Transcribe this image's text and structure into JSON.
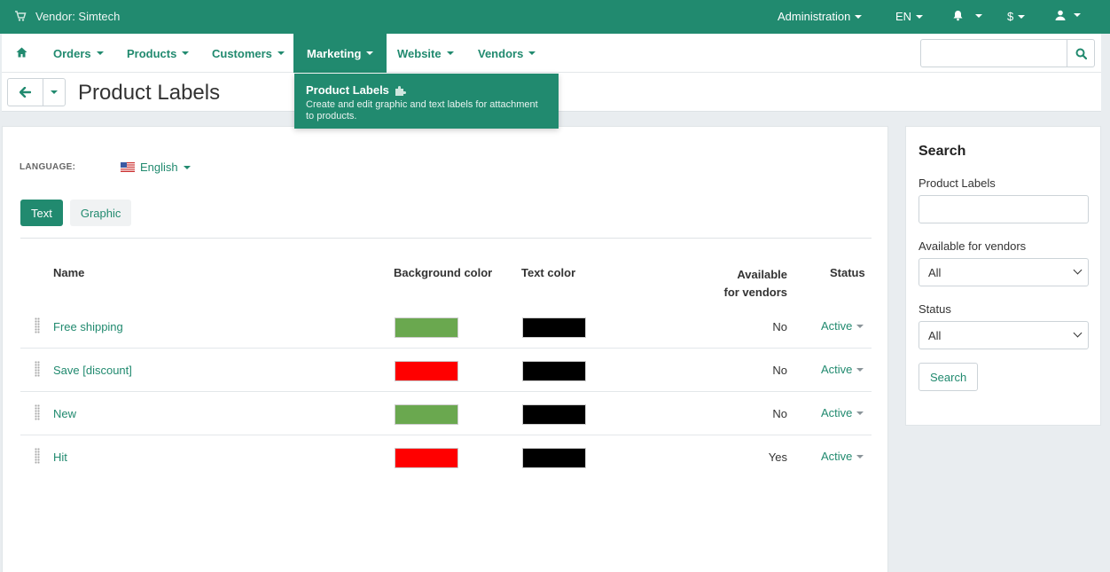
{
  "topbar": {
    "vendor": "Vendor: Simtech",
    "administration": "Administration",
    "language": "EN",
    "currency": "$"
  },
  "nav": {
    "orders": "Orders",
    "products": "Products",
    "customers": "Customers",
    "marketing": "Marketing",
    "website": "Website",
    "vendors": "Vendors",
    "search_placeholder": ""
  },
  "page": {
    "title": "Product Labels"
  },
  "dropdown": {
    "title": "Product Labels",
    "description": "Create and edit graphic and text labels for attachment to products."
  },
  "main": {
    "language_label": "LANGUAGE:",
    "language_value": "English",
    "tabs": [
      "Text",
      "Graphic"
    ],
    "columns": {
      "name": "Name",
      "background": "Background color",
      "text_color": "Text color",
      "available_line1": "Available",
      "available_line2": "for vendors",
      "status": "Status"
    },
    "rows": [
      {
        "name": "Free shipping",
        "bg": "#6aa84f",
        "fg": "#000000",
        "available": "No",
        "status": "Active"
      },
      {
        "name": "Save [discount]",
        "bg": "#ff0000",
        "fg": "#000000",
        "available": "No",
        "status": "Active"
      },
      {
        "name": "New",
        "bg": "#6aa84f",
        "fg": "#000000",
        "available": "No",
        "status": "Active"
      },
      {
        "name": "Hit",
        "bg": "#ff0000",
        "fg": "#000000",
        "available": "Yes",
        "status": "Active"
      }
    ]
  },
  "sidebar": {
    "title": "Search",
    "product_labels_label": "Product Labels",
    "product_labels_value": "",
    "available_label": "Available for vendors",
    "available_value": "All",
    "status_label": "Status",
    "status_value": "All",
    "search_button": "Search"
  },
  "colors": {
    "accent": "#218a6f"
  }
}
